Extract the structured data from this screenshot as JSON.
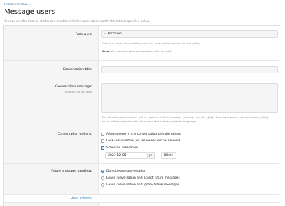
{
  "breadcrumb": {
    "label": "Communication",
    "separator": "›"
  },
  "page": {
    "title": "Message users",
    "description": "You can use this form to start a conversation with the users which match the criteria specified below."
  },
  "form": {
    "from_user": {
      "label": "From user:",
      "value": "El Porcharo",
      "hint": "Enter the name of an existing user the conversation should be started by.",
      "note_label": "Note:",
      "note_text": "You cannot start a conversation with yourself."
    },
    "conversation_title": {
      "label": "Conversation title:",
      "value": ""
    },
    "conversation_message": {
      "label": "Conversation message:",
      "sublabel": "You may use BB code",
      "value": "",
      "hint_line1": "The following placeholders will be replaced in the message: {name}, {email}, {id}. You may also use {phrase:phrase_title}",
      "hint_line2": "which will be replaced with the phrase text in the recipient's language."
    },
    "conversation_options": {
      "label": "Conversation options:",
      "options": [
        {
          "label": "Allow anyone in the conversation to invite others",
          "checked": false
        },
        {
          "label": "Lock conversation (no responses will be allowed)",
          "checked": false
        },
        {
          "label": "Schedule publication",
          "checked": true
        }
      ],
      "date": "2023-12-05",
      "time_separator": "-",
      "time": "00:04"
    },
    "future_message_handling": {
      "label": "Future message handling:",
      "options": [
        {
          "label": "Do not leave conversation",
          "selected": true
        },
        {
          "label": "Leave conversation and accept future messages",
          "selected": false
        },
        {
          "label": "Leave conversation and ignore future messages",
          "selected": false
        }
      ]
    }
  },
  "tabs": {
    "user_criteria": "User criteria"
  },
  "colors": {
    "accent": "#2577b1",
    "muted": "#8c8c8c",
    "panel": "#f5f5f5"
  },
  "icons": {
    "calendar": "calendar-icon",
    "checkmark": "checkmark-icon"
  }
}
